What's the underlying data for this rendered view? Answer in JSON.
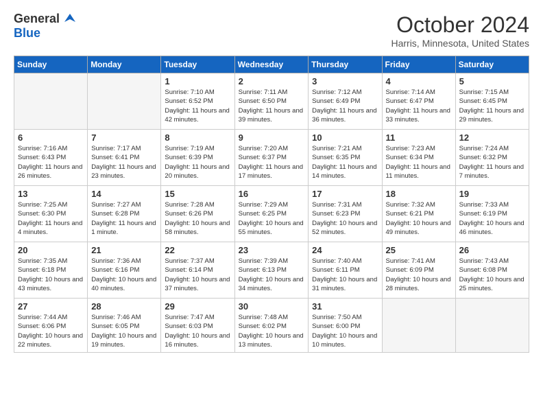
{
  "header": {
    "logo_general": "General",
    "logo_blue": "Blue",
    "month": "October 2024",
    "location": "Harris, Minnesota, United States"
  },
  "weekdays": [
    "Sunday",
    "Monday",
    "Tuesday",
    "Wednesday",
    "Thursday",
    "Friday",
    "Saturday"
  ],
  "weeks": [
    [
      {
        "day": "",
        "empty": true
      },
      {
        "day": "",
        "empty": true
      },
      {
        "day": "1",
        "sunrise": "Sunrise: 7:10 AM",
        "sunset": "Sunset: 6:52 PM",
        "daylight": "Daylight: 11 hours and 42 minutes."
      },
      {
        "day": "2",
        "sunrise": "Sunrise: 7:11 AM",
        "sunset": "Sunset: 6:50 PM",
        "daylight": "Daylight: 11 hours and 39 minutes."
      },
      {
        "day": "3",
        "sunrise": "Sunrise: 7:12 AM",
        "sunset": "Sunset: 6:49 PM",
        "daylight": "Daylight: 11 hours and 36 minutes."
      },
      {
        "day": "4",
        "sunrise": "Sunrise: 7:14 AM",
        "sunset": "Sunset: 6:47 PM",
        "daylight": "Daylight: 11 hours and 33 minutes."
      },
      {
        "day": "5",
        "sunrise": "Sunrise: 7:15 AM",
        "sunset": "Sunset: 6:45 PM",
        "daylight": "Daylight: 11 hours and 29 minutes."
      }
    ],
    [
      {
        "day": "6",
        "sunrise": "Sunrise: 7:16 AM",
        "sunset": "Sunset: 6:43 PM",
        "daylight": "Daylight: 11 hours and 26 minutes."
      },
      {
        "day": "7",
        "sunrise": "Sunrise: 7:17 AM",
        "sunset": "Sunset: 6:41 PM",
        "daylight": "Daylight: 11 hours and 23 minutes."
      },
      {
        "day": "8",
        "sunrise": "Sunrise: 7:19 AM",
        "sunset": "Sunset: 6:39 PM",
        "daylight": "Daylight: 11 hours and 20 minutes."
      },
      {
        "day": "9",
        "sunrise": "Sunrise: 7:20 AM",
        "sunset": "Sunset: 6:37 PM",
        "daylight": "Daylight: 11 hours and 17 minutes."
      },
      {
        "day": "10",
        "sunrise": "Sunrise: 7:21 AM",
        "sunset": "Sunset: 6:35 PM",
        "daylight": "Daylight: 11 hours and 14 minutes."
      },
      {
        "day": "11",
        "sunrise": "Sunrise: 7:23 AM",
        "sunset": "Sunset: 6:34 PM",
        "daylight": "Daylight: 11 hours and 11 minutes."
      },
      {
        "day": "12",
        "sunrise": "Sunrise: 7:24 AM",
        "sunset": "Sunset: 6:32 PM",
        "daylight": "Daylight: 11 hours and 7 minutes."
      }
    ],
    [
      {
        "day": "13",
        "sunrise": "Sunrise: 7:25 AM",
        "sunset": "Sunset: 6:30 PM",
        "daylight": "Daylight: 11 hours and 4 minutes."
      },
      {
        "day": "14",
        "sunrise": "Sunrise: 7:27 AM",
        "sunset": "Sunset: 6:28 PM",
        "daylight": "Daylight: 11 hours and 1 minute."
      },
      {
        "day": "15",
        "sunrise": "Sunrise: 7:28 AM",
        "sunset": "Sunset: 6:26 PM",
        "daylight": "Daylight: 10 hours and 58 minutes."
      },
      {
        "day": "16",
        "sunrise": "Sunrise: 7:29 AM",
        "sunset": "Sunset: 6:25 PM",
        "daylight": "Daylight: 10 hours and 55 minutes."
      },
      {
        "day": "17",
        "sunrise": "Sunrise: 7:31 AM",
        "sunset": "Sunset: 6:23 PM",
        "daylight": "Daylight: 10 hours and 52 minutes."
      },
      {
        "day": "18",
        "sunrise": "Sunrise: 7:32 AM",
        "sunset": "Sunset: 6:21 PM",
        "daylight": "Daylight: 10 hours and 49 minutes."
      },
      {
        "day": "19",
        "sunrise": "Sunrise: 7:33 AM",
        "sunset": "Sunset: 6:19 PM",
        "daylight": "Daylight: 10 hours and 46 minutes."
      }
    ],
    [
      {
        "day": "20",
        "sunrise": "Sunrise: 7:35 AM",
        "sunset": "Sunset: 6:18 PM",
        "daylight": "Daylight: 10 hours and 43 minutes."
      },
      {
        "day": "21",
        "sunrise": "Sunrise: 7:36 AM",
        "sunset": "Sunset: 6:16 PM",
        "daylight": "Daylight: 10 hours and 40 minutes."
      },
      {
        "day": "22",
        "sunrise": "Sunrise: 7:37 AM",
        "sunset": "Sunset: 6:14 PM",
        "daylight": "Daylight: 10 hours and 37 minutes."
      },
      {
        "day": "23",
        "sunrise": "Sunrise: 7:39 AM",
        "sunset": "Sunset: 6:13 PM",
        "daylight": "Daylight: 10 hours and 34 minutes."
      },
      {
        "day": "24",
        "sunrise": "Sunrise: 7:40 AM",
        "sunset": "Sunset: 6:11 PM",
        "daylight": "Daylight: 10 hours and 31 minutes."
      },
      {
        "day": "25",
        "sunrise": "Sunrise: 7:41 AM",
        "sunset": "Sunset: 6:09 PM",
        "daylight": "Daylight: 10 hours and 28 minutes."
      },
      {
        "day": "26",
        "sunrise": "Sunrise: 7:43 AM",
        "sunset": "Sunset: 6:08 PM",
        "daylight": "Daylight: 10 hours and 25 minutes."
      }
    ],
    [
      {
        "day": "27",
        "sunrise": "Sunrise: 7:44 AM",
        "sunset": "Sunset: 6:06 PM",
        "daylight": "Daylight: 10 hours and 22 minutes."
      },
      {
        "day": "28",
        "sunrise": "Sunrise: 7:46 AM",
        "sunset": "Sunset: 6:05 PM",
        "daylight": "Daylight: 10 hours and 19 minutes."
      },
      {
        "day": "29",
        "sunrise": "Sunrise: 7:47 AM",
        "sunset": "Sunset: 6:03 PM",
        "daylight": "Daylight: 10 hours and 16 minutes."
      },
      {
        "day": "30",
        "sunrise": "Sunrise: 7:48 AM",
        "sunset": "Sunset: 6:02 PM",
        "daylight": "Daylight: 10 hours and 13 minutes."
      },
      {
        "day": "31",
        "sunrise": "Sunrise: 7:50 AM",
        "sunset": "Sunset: 6:00 PM",
        "daylight": "Daylight: 10 hours and 10 minutes."
      },
      {
        "day": "",
        "empty": true
      },
      {
        "day": "",
        "empty": true
      }
    ]
  ]
}
